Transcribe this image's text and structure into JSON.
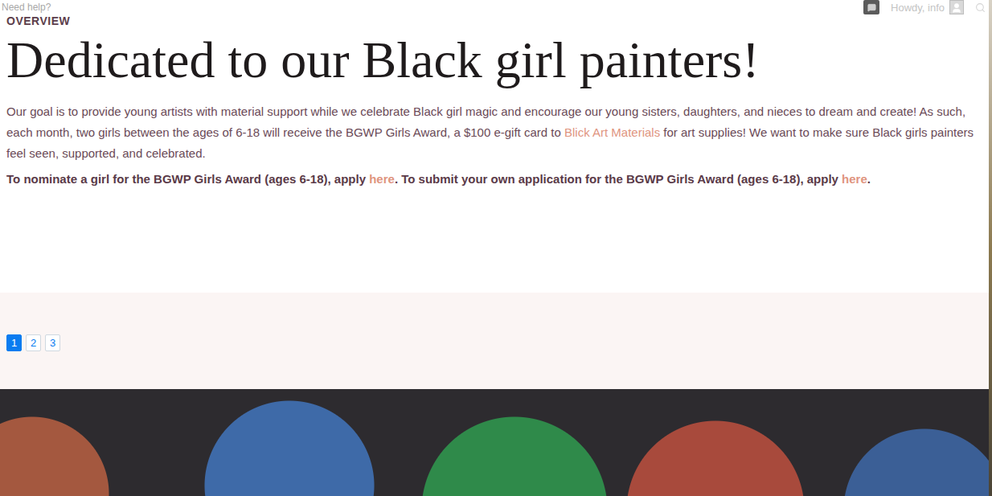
{
  "top_bar": {
    "help": "Need help?",
    "greeting": "Howdy, info"
  },
  "section_label": "OVERVIEW",
  "title": "Dedicated to our Black girl painters!",
  "intro": [
    {
      "kind": "text",
      "text": "Our goal is to provide young artists with material support while we celebrate Black girl magic and encourage our young sisters, daughters, and nieces to dream and create! As such, each month, two girls between the ages of 6-18 will receive the BGWP Girls Award, a $100 e-gift card to "
    },
    {
      "kind": "link",
      "text": "Blick Art Materials"
    },
    {
      "kind": "text",
      "text": " for art supplies! We want to make sure Black girls painters feel seen, supported, and celebrated."
    }
  ],
  "cta": [
    {
      "kind": "text",
      "text": "To nominate a girl for the BGWP Girls Award (ages 6-18), apply "
    },
    {
      "kind": "link",
      "text": "here"
    },
    {
      "kind": "text",
      "text": ". To submit your own application for the BGWP Girls Award (ages 6-18), apply "
    },
    {
      "kind": "link",
      "text": "here"
    },
    {
      "kind": "text",
      "text": "."
    }
  ],
  "pagination": [
    {
      "label": "1",
      "selected": true
    },
    {
      "label": "2",
      "selected": false
    },
    {
      "label": "3",
      "selected": false
    }
  ]
}
